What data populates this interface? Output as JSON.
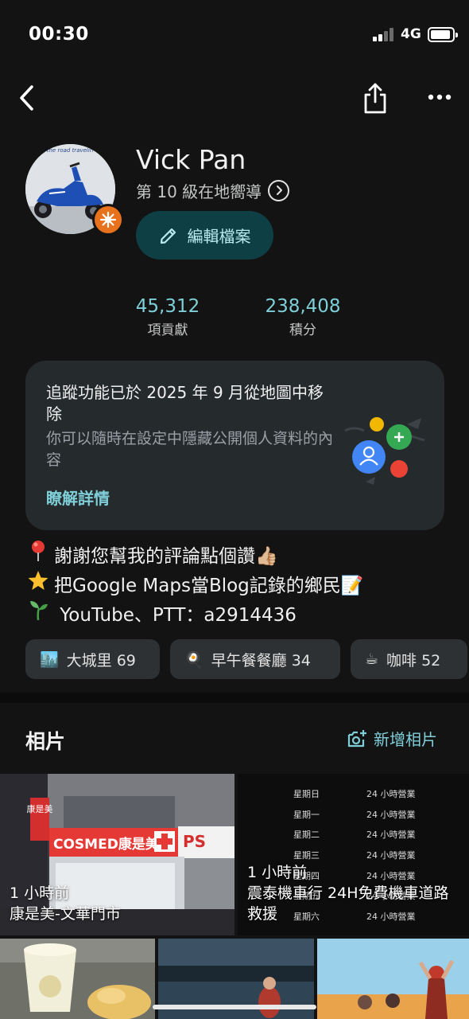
{
  "status_bar": {
    "time": "00:30",
    "network": "4G"
  },
  "profile": {
    "name": "Vick Pan",
    "level": "第 10 級在地嚮導",
    "edit_label": "編輯檔案",
    "avatar_text": "the road travelin"
  },
  "stats": [
    {
      "value": "45,312",
      "label": "項貢獻"
    },
    {
      "value": "238,408",
      "label": "積分"
    }
  ],
  "notice": {
    "title": "追蹤功能已於 2025 年 9 月從地圖中移除",
    "body": "你可以隨時在設定中隱藏公開個人資料的內容",
    "link": "瞭解詳情"
  },
  "bio": [
    {
      "icon": "pushpin-icon",
      "text": "謝謝您幫我的評論點個讚👍🏼"
    },
    {
      "icon": "star-icon",
      "text": "把Google Maps當Blog記錄的鄉民📝"
    },
    {
      "icon": "seedling-icon",
      "text": " YouTube、PTT：a2914436"
    }
  ],
  "chips": [
    {
      "emoji": "🏙️",
      "label": "大城里 69"
    },
    {
      "emoji": "🍳",
      "label": "早午餐餐廳 34"
    },
    {
      "emoji": "☕",
      "label": "咖啡 52"
    }
  ],
  "photos": {
    "title": "相片",
    "add_label": "新增相片",
    "items": [
      {
        "time": "1 小時前",
        "place": "康是美-文華門市",
        "sign_text": "COSMED康是美",
        "sign_text_2": "康是美",
        "shop_sign": "PS"
      },
      {
        "time": "1 小時前",
        "place": "震泰機車行 24H免費機車道路救援"
      }
    ],
    "hours": [
      {
        "day": "星期日",
        "hours": "24 小時營業"
      },
      {
        "day": "星期一",
        "hours": "24 小時營業"
      },
      {
        "day": "星期二",
        "hours": "24 小時營業"
      },
      {
        "day": "星期三",
        "hours": "24 小時營業"
      },
      {
        "day": "星期四",
        "hours": "24 小時營業"
      },
      {
        "day": "星期五",
        "hours": "24 小時營業"
      },
      {
        "day": "星期六",
        "hours": "24 小時營業"
      }
    ]
  },
  "colors": {
    "accent": "#7fcfd9",
    "background": "#131314",
    "card": "#252a2d",
    "edit_button": "#0e3f45",
    "badge": "#e8711c"
  }
}
